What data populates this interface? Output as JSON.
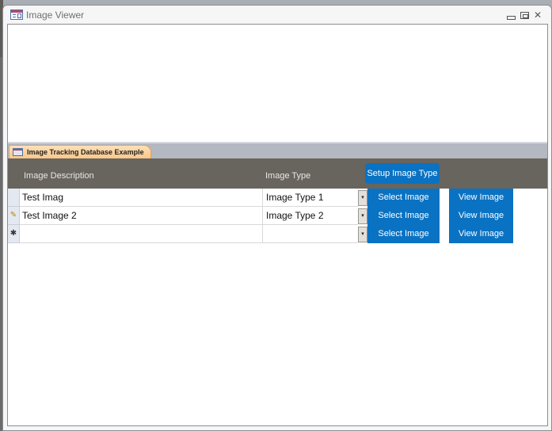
{
  "window": {
    "title": "Image Viewer",
    "controls": {
      "minimize": "minimize",
      "restore": "restore",
      "close": "✕"
    }
  },
  "document_tab": {
    "label": "Image Tracking Database Example"
  },
  "form": {
    "headers": {
      "description": "Image Description",
      "type": "Image Type"
    },
    "setup_button_label": "Setup Image Type",
    "rows": [
      {
        "selector": "",
        "description": "Test Imag",
        "type": "Image Type 1",
        "select_label": "Select Image",
        "view_label": "View Image"
      },
      {
        "selector": "✎",
        "description": "Test Image 2",
        "type": "Image Type 2",
        "select_label": "Select Image",
        "view_label": "View Image"
      },
      {
        "selector": "✱",
        "description": "",
        "type": "",
        "select_label": "Select Image",
        "view_label": "View Image"
      }
    ],
    "dropdown_glyph": "▾"
  },
  "colors": {
    "accent_button": "#0a72c2",
    "header_bg": "#68645e",
    "tab_bg": "#f9c68a"
  }
}
